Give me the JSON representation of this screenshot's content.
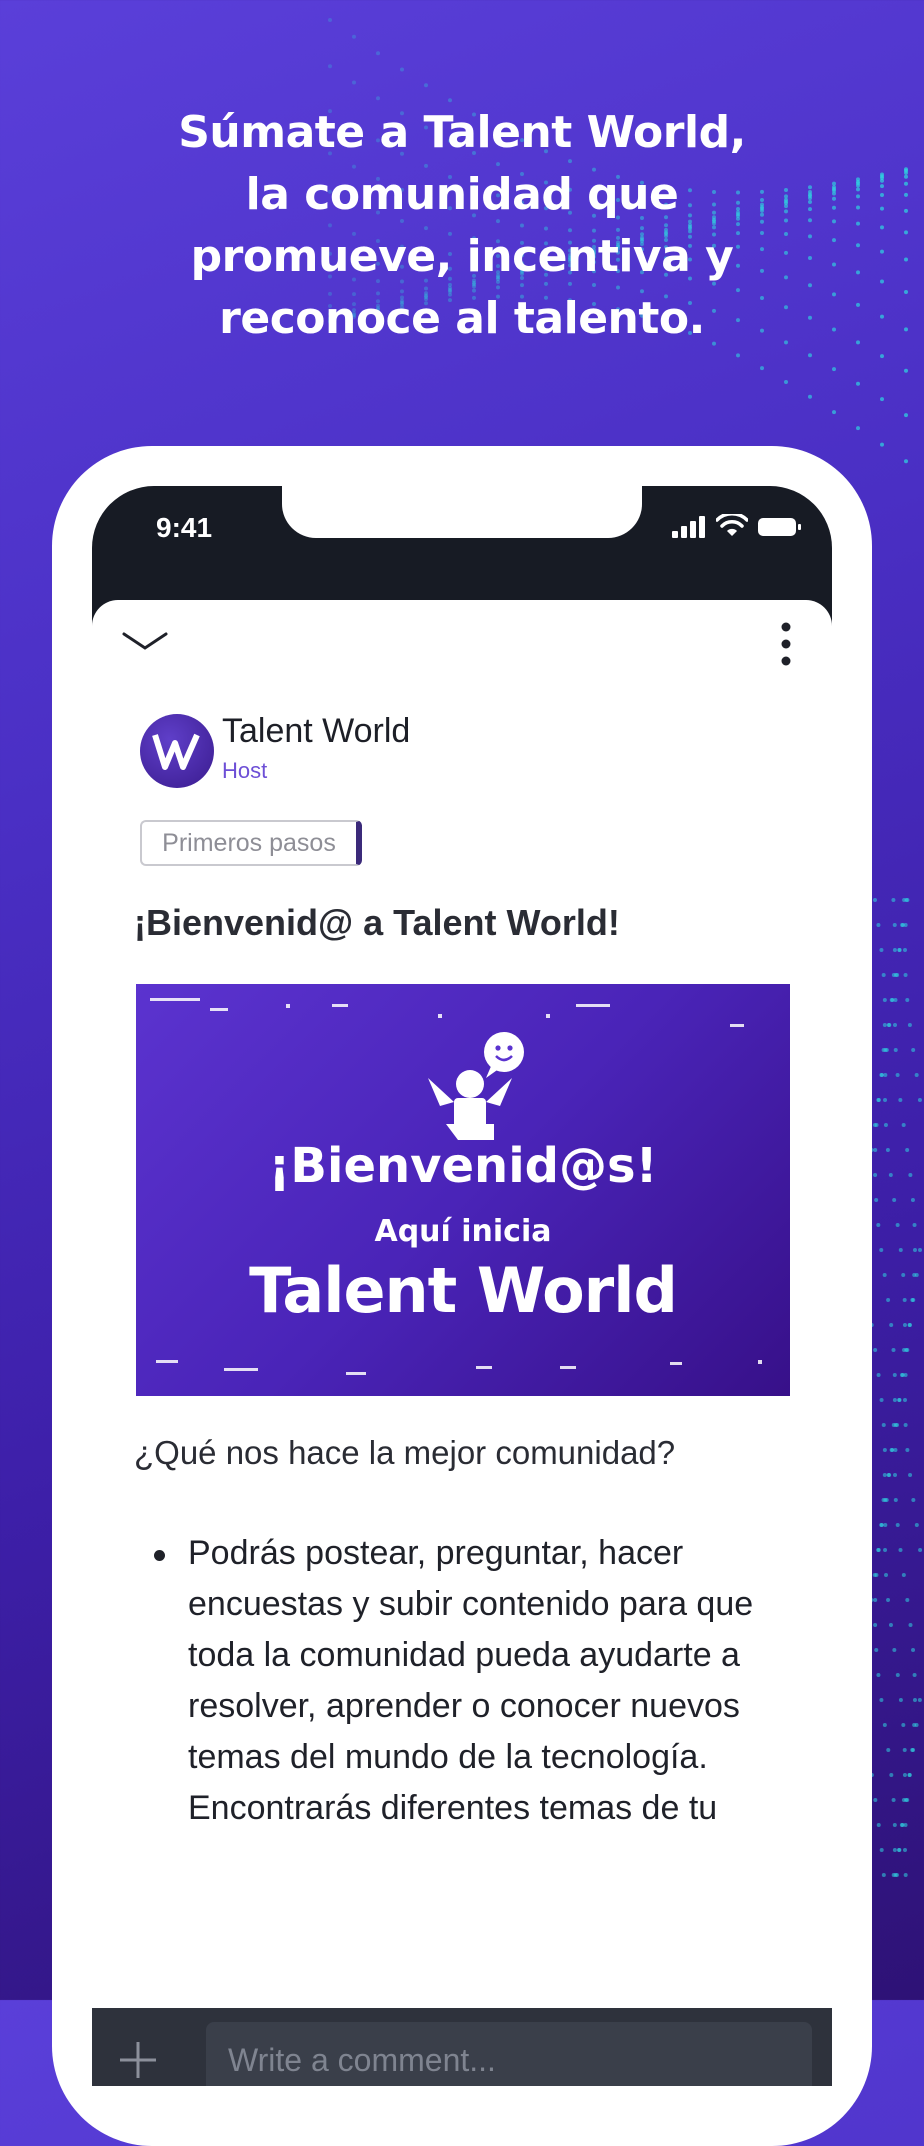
{
  "headline": {
    "line1": "Súmate a Talent World,",
    "line2": "la comunidad que",
    "line3": "promueve, incentiva y",
    "line4": "reconoce al talento."
  },
  "status_bar": {
    "time": "9:41",
    "icons": [
      "signal-icon",
      "wifi-icon",
      "battery-icon"
    ]
  },
  "post": {
    "author_name": "Talent World",
    "author_role": "Host",
    "tag": "Primeros pasos",
    "title": "¡Bienvenid@ a Talent World!",
    "banner": {
      "title": "¡Bienvenid@s!",
      "subtitle": "Aquí inicia",
      "brand": "Talent World"
    },
    "question": "¿Qué nos hace la mejor comunidad?",
    "bullets": [
      "Podrás postear, preguntar, hacer encuestas y subir contenido para que toda la comunidad pueda ayudarte a resolver, aprender o conocer nuevos temas del mundo de la tecnología.",
      "Encontrarás diferentes temas de tu"
    ]
  },
  "comment": {
    "placeholder": "Write a comment..."
  },
  "colors": {
    "background": "#4a2fc4",
    "accent": "#6d4fd6",
    "dots": "#2fd3e0",
    "comment_bar": "#2e323c"
  }
}
